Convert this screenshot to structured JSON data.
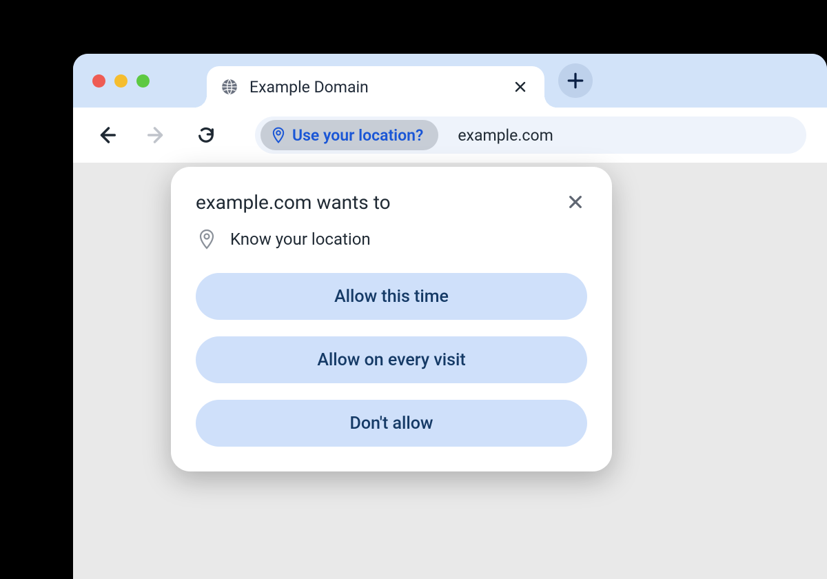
{
  "tab": {
    "title": "Example Domain"
  },
  "address_bar": {
    "permission_chip": "Use your location?",
    "url": "example.com"
  },
  "popup": {
    "title": "example.com wants to",
    "permission": "Know your location",
    "buttons": {
      "allow_once": "Allow this time",
      "allow_always": "Allow on every visit",
      "deny": "Don't allow"
    }
  }
}
